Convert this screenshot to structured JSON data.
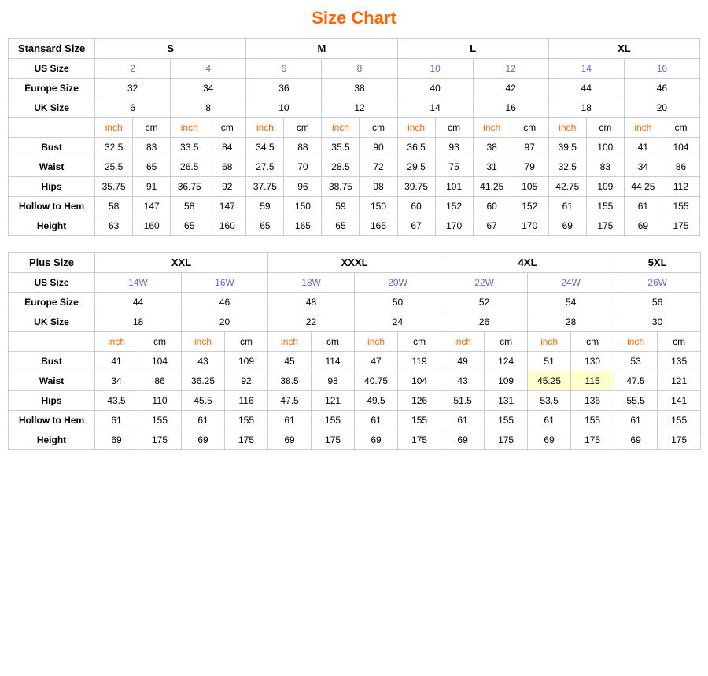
{
  "title": "Size Chart",
  "standard": {
    "caption": "Stansard Size",
    "sizes": [
      "S",
      "M",
      "L",
      "XL"
    ],
    "size_spans": [
      2,
      2,
      2,
      2
    ],
    "us_sizes": [
      "2",
      "4",
      "6",
      "8",
      "10",
      "12",
      "14",
      "16"
    ],
    "europe_sizes": [
      "32",
      "34",
      "36",
      "38",
      "40",
      "42",
      "44",
      "46"
    ],
    "uk_sizes": [
      "6",
      "8",
      "10",
      "12",
      "14",
      "16",
      "18",
      "20"
    ],
    "measurements": {
      "bust": [
        "32.5",
        "83",
        "33.5",
        "84",
        "34.5",
        "88",
        "35.5",
        "90",
        "36.5",
        "93",
        "38",
        "97",
        "39.5",
        "100",
        "41",
        "104"
      ],
      "waist": [
        "25.5",
        "65",
        "26.5",
        "68",
        "27.5",
        "70",
        "28.5",
        "72",
        "29.5",
        "75",
        "31",
        "79",
        "32.5",
        "83",
        "34",
        "86"
      ],
      "hips": [
        "35.75",
        "91",
        "36.75",
        "92",
        "37.75",
        "96",
        "38.75",
        "98",
        "39.75",
        "101",
        "41.25",
        "105",
        "42.75",
        "109",
        "44.25",
        "112"
      ],
      "hollow_hem": [
        "58",
        "147",
        "58",
        "147",
        "59",
        "150",
        "59",
        "150",
        "60",
        "152",
        "60",
        "152",
        "61",
        "155",
        "61",
        "155"
      ],
      "height": [
        "63",
        "160",
        "65",
        "160",
        "65",
        "165",
        "65",
        "165",
        "67",
        "170",
        "67",
        "170",
        "69",
        "175",
        "69",
        "175"
      ]
    }
  },
  "plus": {
    "caption": "Plus Size",
    "sizes": [
      "XXL",
      "XXXL",
      "4XL",
      "5XL"
    ],
    "size_spans": [
      2,
      2,
      2,
      1
    ],
    "us_sizes": [
      "14W",
      "16W",
      "18W",
      "20W",
      "22W",
      "24W",
      "26W"
    ],
    "europe_sizes": [
      "44",
      "46",
      "48",
      "50",
      "52",
      "54",
      "56"
    ],
    "uk_sizes": [
      "18",
      "20",
      "22",
      "24",
      "26",
      "28",
      "30"
    ],
    "measurements": {
      "bust": [
        "41",
        "104",
        "43",
        "109",
        "45",
        "114",
        "47",
        "119",
        "49",
        "124",
        "51",
        "130",
        "53",
        "135"
      ],
      "waist": [
        "34",
        "86",
        "36.25",
        "92",
        "38.5",
        "98",
        "40.75",
        "104",
        "43",
        "109",
        "45.25",
        "115",
        "47.5",
        "121"
      ],
      "hips": [
        "43.5",
        "110",
        "45.5",
        "116",
        "47.5",
        "121",
        "49.5",
        "126",
        "51.5",
        "131",
        "53.5",
        "136",
        "55.5",
        "141"
      ],
      "hollow_hem": [
        "61",
        "155",
        "61",
        "155",
        "61",
        "155",
        "61",
        "155",
        "61",
        "155",
        "61",
        "155",
        "61",
        "155"
      ],
      "height": [
        "69",
        "175",
        "69",
        "175",
        "69",
        "175",
        "69",
        "175",
        "69",
        "175",
        "69",
        "175",
        "69",
        "175"
      ]
    },
    "highlight_col_indices": [
      12,
      13
    ]
  },
  "labels": {
    "inch": "inch",
    "cm": "cm",
    "bust": "Bust",
    "waist": "Waist",
    "hips": "Hips",
    "hollow_hem": "Hollow to Hem",
    "height": "Height",
    "us_size": "US Size",
    "europe_size": "Europe Size",
    "uk_size": "UK Size"
  }
}
